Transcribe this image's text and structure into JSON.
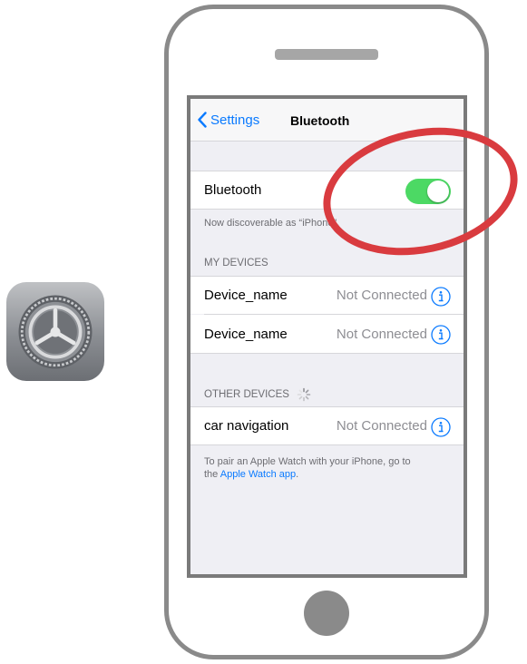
{
  "navbar": {
    "back_label": "Settings",
    "title": "Bluetooth"
  },
  "bluetooth_row": {
    "label": "Bluetooth",
    "toggle_on": true
  },
  "discoverable_text": "Now discoverable as “iPhone”.",
  "my_devices": {
    "header": "MY DEVICES",
    "items": [
      {
        "name": "Device_name",
        "status": "Not Connected"
      },
      {
        "name": "Device_name",
        "status": "Not Connected"
      }
    ]
  },
  "other_devices": {
    "header": "OTHER DEVICES",
    "items": [
      {
        "name": "car navigation",
        "status": "Not Connected"
      }
    ]
  },
  "footer": {
    "text_line1": "To pair an Apple Watch with your iPhone, go to",
    "text_prefix": "the ",
    "link": "Apple Watch app",
    "text_suffix": "."
  },
  "colors": {
    "accent": "#0a7aff",
    "toggle_on": "#4cd964",
    "highlight": "#d93b3f"
  }
}
